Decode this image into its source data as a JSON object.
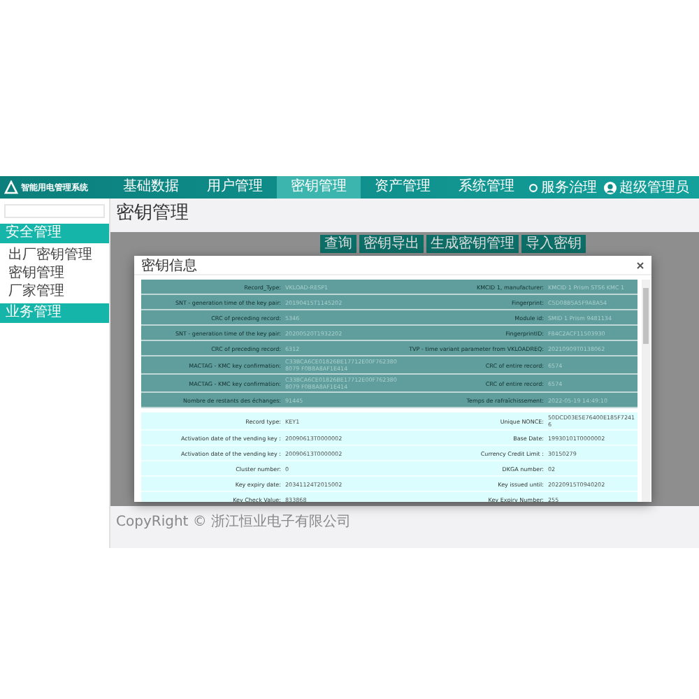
{
  "navbar": {
    "logo": "智能用电管理系统",
    "items": [
      {
        "label": "基础数据",
        "selected": false
      },
      {
        "label": "用户管理",
        "selected": false
      },
      {
        "label": "密钥管理",
        "selected": true
      },
      {
        "label": "资产管理",
        "selected": false
      },
      {
        "label": "系统管理",
        "selected": false
      }
    ],
    "service": "服务治理",
    "user": "超级管理员"
  },
  "sidebar": {
    "items": [
      {
        "kind": "header",
        "label": "安全管理"
      },
      {
        "kind": "link",
        "label": "出厂密钥管理"
      },
      {
        "kind": "link",
        "label": "密钥管理"
      },
      {
        "kind": "link",
        "label": "厂家管理"
      },
      {
        "kind": "header",
        "label": "业务管理"
      }
    ]
  },
  "page": {
    "title": "密钥管理",
    "buttons": [
      "查询",
      "密钥导出",
      "生成密钥管理",
      "导入密钥"
    ]
  },
  "dialog": {
    "title": "密钥信息",
    "sections": [
      {
        "kind": "dark",
        "rows": [
          {
            "label": "Record_Type:",
            "value": "VKLOAD-RESP1",
            "label2": "KMCID 1, manufacturer:",
            "value2": "KMCID 1 Prism STS6 KMC 1"
          },
          {
            "label": "SNT - generation time of the key pair:",
            "value": "20190415T1145202",
            "label2": "Fingerprint:",
            "value2": "C5D08B5A5F9A8A54"
          },
          {
            "label": "CRC of preceding record:",
            "value": "5346",
            "label2": "Module id:",
            "value2": "SMID 1 Prism 9481134"
          },
          {
            "label": "SNT - generation time of the key pair:",
            "value": "20200520T1932202",
            "label2": "FingerprintID:",
            "value2": "F84C2ACF11503930"
          },
          {
            "label": "CRC of preceding record:",
            "value": "6312",
            "label2": "TVP - time variant parameter from VKLOADREQ:",
            "value2": "20210909T0138062"
          },
          {
            "label": "MACTAG - KMC key confirmation:",
            "value": "C33BCA6CE01826BE17712E00F7623808079 F0B8A8AF1E414",
            "label2": "CRC of entire record:",
            "value2": "6574"
          },
          {
            "label": "MACTAG - KMC key confirmation:",
            "value": "C33BCA6CE01826BE17712E00F7623808079 F0B8A8AF1E414",
            "label2": "CRC of entire record:",
            "value2": "6574"
          },
          {
            "label": "Nombre de restants des échanges:",
            "value": "91445",
            "label2": "Temps de rafraîchissement:",
            "value2": "2022-05-19 14:49:10"
          }
        ]
      },
      {
        "kind": "light",
        "rows": [
          {
            "label": "Record type:",
            "value": "KEY1",
            "label2": "Unique NONCE:",
            "value2": "50DCD03E5E76400E185F72416"
          },
          {
            "label": "Activation date of the vending key :",
            "value": "20090613T0000002",
            "label2": "Base Date:",
            "value2": "19930101T0000002"
          },
          {
            "label": "Activation date of the vending key :",
            "value": "20090613T0000002",
            "label2": "Currency Credit Limit :",
            "value2": "30150279"
          },
          {
            "label": "Cluster number:",
            "value": "0",
            "label2": "DKGA number:",
            "value2": "02"
          },
          {
            "label": "Key expiry date:",
            "value": "20341124T2015002",
            "label2": "Key issued until:",
            "value2": "20220915T0940202"
          },
          {
            "label": "Key Check Value:",
            "value": "833868",
            "label2": "Key Expiry Number:",
            "value2": "255"
          }
        ]
      }
    ]
  },
  "footer": "CopyRight © 浙江恒业电子有限公司"
}
